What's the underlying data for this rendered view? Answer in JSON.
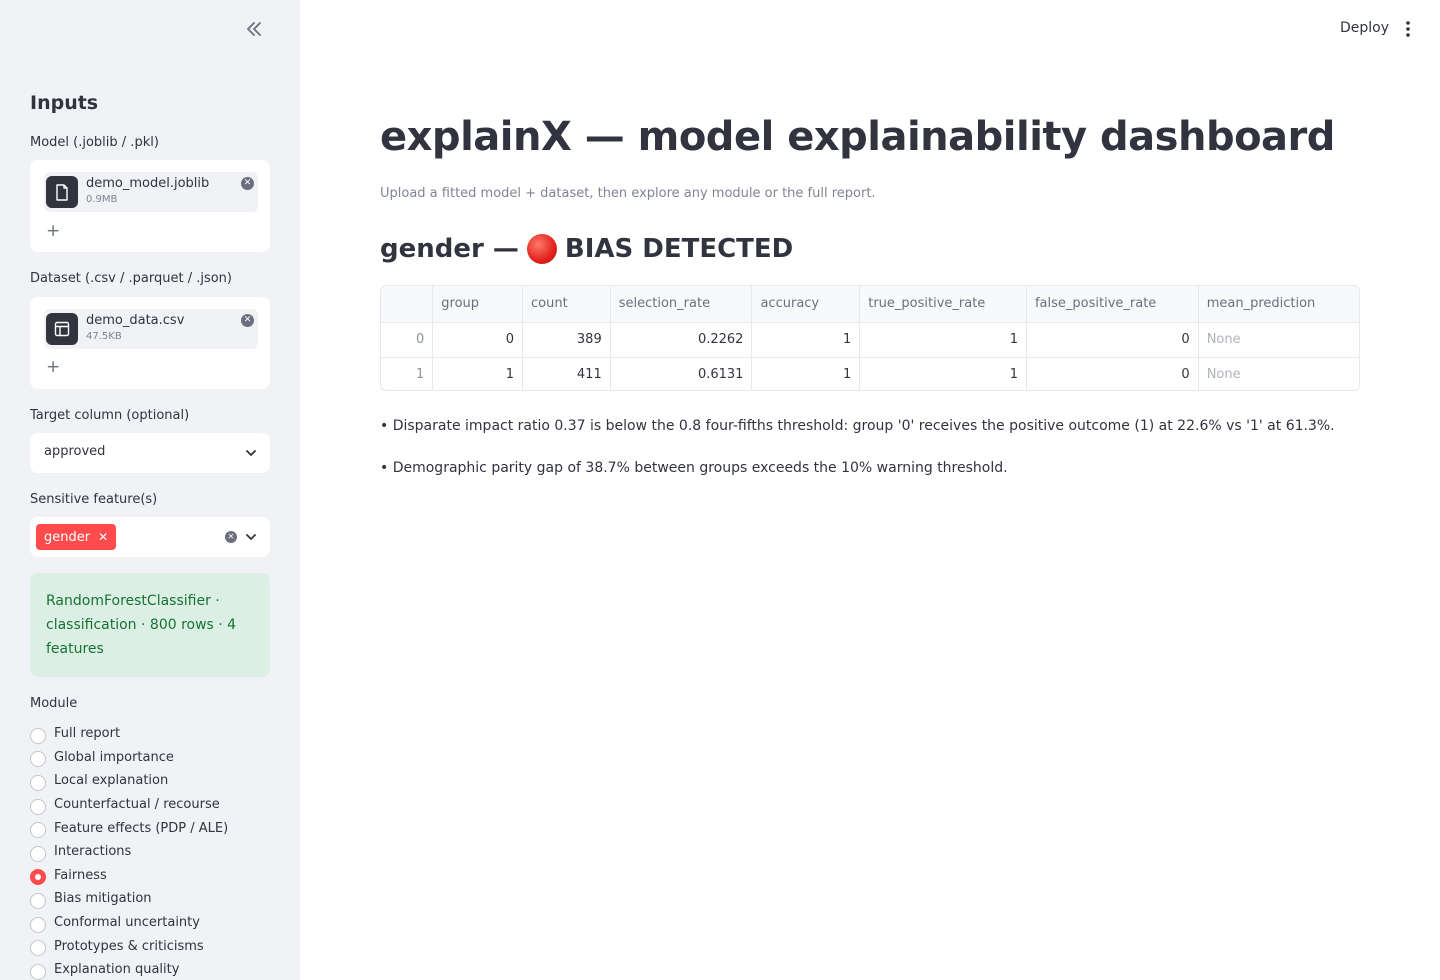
{
  "sidebar": {
    "heading": "Inputs",
    "model_label": "Model (.joblib / .pkl)",
    "model_file": {
      "name": "demo_model.joblib",
      "size": "0.9MB"
    },
    "dataset_label": "Dataset (.csv / .parquet / .json)",
    "dataset_file": {
      "name": "demo_data.csv",
      "size": "47.5KB"
    },
    "add_symbol": "+",
    "target_label": "Target column (optional)",
    "target_value": "approved",
    "sensitive_label": "Sensitive feature(s)",
    "sensitive_tag": "gender",
    "info": "RandomForestClassifier · classification · 800 rows · 4 features",
    "module_label": "Module",
    "modules": [
      {
        "label": "Full report",
        "selected": false
      },
      {
        "label": "Global importance",
        "selected": false
      },
      {
        "label": "Local explanation",
        "selected": false
      },
      {
        "label": "Counterfactual / recourse",
        "selected": false
      },
      {
        "label": "Feature effects (PDP / ALE)",
        "selected": false
      },
      {
        "label": "Interactions",
        "selected": false
      },
      {
        "label": "Fairness",
        "selected": true
      },
      {
        "label": "Bias mitigation",
        "selected": false
      },
      {
        "label": "Conformal uncertainty",
        "selected": false
      },
      {
        "label": "Prototypes & criticisms",
        "selected": false
      },
      {
        "label": "Explanation quality",
        "selected": false
      }
    ]
  },
  "header": {
    "deploy_label": "Deploy"
  },
  "main": {
    "title": "explainX — model explainability dashboard",
    "caption": "Upload a fitted model + dataset, then explore any module or the full report.",
    "section_prefix": "gender —",
    "section_status": "BIAS DETECTED",
    "table": {
      "columns": [
        "",
        "group",
        "count",
        "selection_rate",
        "accuracy",
        "true_positive_rate",
        "false_positive_rate",
        "mean_prediction"
      ],
      "rows": [
        [
          "0",
          "0",
          "389",
          "0.2262",
          "1",
          "1",
          "0",
          "None"
        ],
        [
          "1",
          "1",
          "411",
          "0.6131",
          "1",
          "1",
          "0",
          "None"
        ]
      ]
    },
    "bullets": [
      "• Disparate impact ratio 0.37 is below the 0.8 four-fifths threshold: group '0' receives the positive outcome (1) at 22.6% vs '1' at 61.3%.",
      "• Demographic parity gap of 38.7% between groups exceeds the 10% warning threshold."
    ]
  },
  "colors": {
    "accent": "#ff4b4b",
    "success_bg": "#dcefe5",
    "success_text": "#177233",
    "sidebar_bg": "#f0f2f6"
  }
}
